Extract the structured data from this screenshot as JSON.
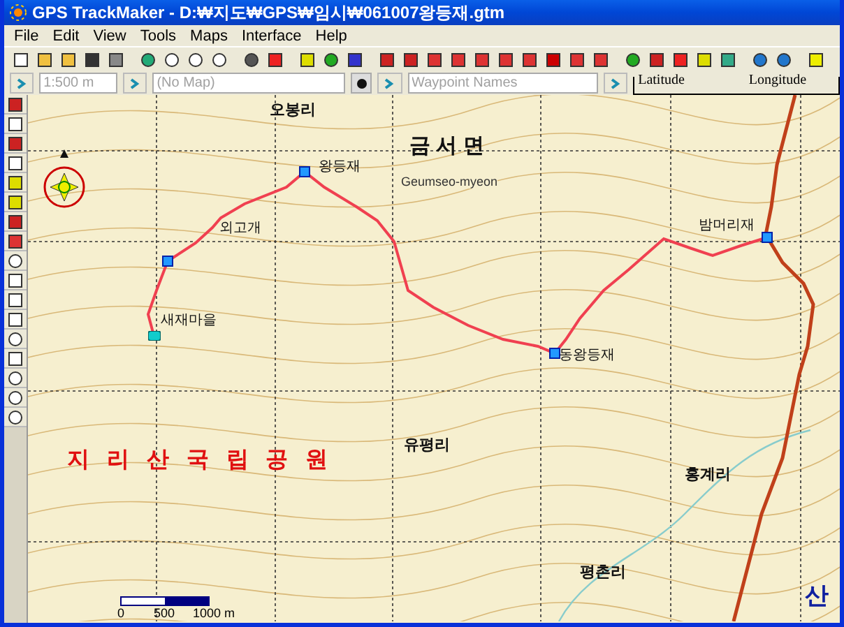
{
  "window": {
    "title": "GPS TrackMaker - D:₩지도₩GPS₩임시₩061007왕등재.gtm"
  },
  "menu": [
    "File",
    "Edit",
    "View",
    "Tools",
    "Maps",
    "Interface",
    "Help"
  ],
  "fields": [
    {
      "kind": "scale",
      "placeholder": "1:500 m"
    },
    {
      "kind": "map",
      "placeholder": "(No Map)"
    },
    {
      "kind": "names",
      "placeholder": "Waypoint Names"
    }
  ],
  "coordinates": {
    "latitude": "Latitude",
    "longitude": "Longitude"
  },
  "map": {
    "labels": [
      {
        "kind": "village",
        "text": "오봉리"
      },
      {
        "kind": "region",
        "text": "금 서 면"
      },
      {
        "kind": "romanized",
        "text": "Geumseo-myeon"
      },
      {
        "kind": "waypoint",
        "text": "왕등재"
      },
      {
        "kind": "small",
        "text": "외고개"
      },
      {
        "kind": "waypoint",
        "text": "새재마을"
      },
      {
        "kind": "waypoint",
        "text": "밤머리재"
      },
      {
        "kind": "waypoint",
        "text": "동왕등재"
      },
      {
        "kind": "village",
        "text": "유평리"
      },
      {
        "kind": "park",
        "text": "지 리 산 국 립 공 원"
      },
      {
        "kind": "village",
        "text": "홍계리"
      },
      {
        "kind": "village",
        "text": "평촌리"
      },
      {
        "kind": "edge",
        "text": "산"
      }
    ],
    "scale": [
      "0",
      "500",
      "1000 m"
    ]
  }
}
